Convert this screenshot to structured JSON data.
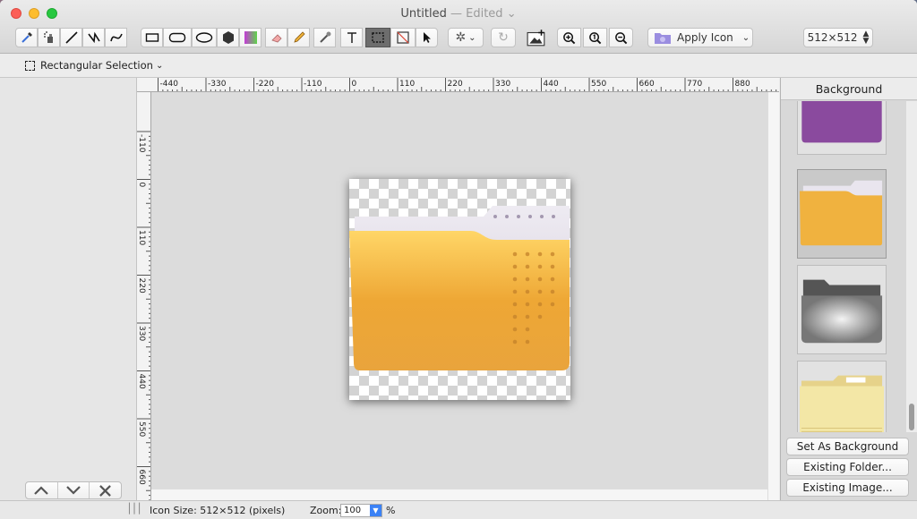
{
  "window": {
    "title": "Untitled",
    "edited": "— Edited"
  },
  "toolbar": {
    "apply_icon_label": "Apply Icon",
    "size_value": "512×512"
  },
  "optionsbar": {
    "tool_name": "Rectangular Selection"
  },
  "ruler": {
    "h": [
      "-440",
      "-330",
      "-220",
      "-110",
      "0",
      "110",
      "220",
      "330",
      "440",
      "550",
      "660",
      "770",
      "880"
    ],
    "v": [
      "-110",
      "0",
      "110",
      "220",
      "330",
      "440",
      "550",
      "660"
    ]
  },
  "panel": {
    "title": "Background",
    "buttons": [
      "Set As Background",
      "Existing Folder...",
      "Existing Image..."
    ]
  },
  "status": {
    "icon_size": "Icon Size: 512×512 (pixels)",
    "zoom_label": "Zoom:",
    "zoom_value": "100",
    "zoom_unit": "%"
  },
  "colors": {
    "accent": "#3b82f6",
    "folder_yellow": "#f2b43d",
    "selected_tool": "#6d6d6d"
  },
  "icons": [
    "eyedropper",
    "spray",
    "line",
    "zigzag",
    "curve",
    "rectangle",
    "rounded-rect",
    "ellipse",
    "hexagon",
    "gradient",
    "eraser",
    "pencil",
    "stamp",
    "text",
    "marquee",
    "crop",
    "arrow",
    "gear",
    "rotate",
    "image-add",
    "zoom-in",
    "zoom-actual",
    "zoom-out",
    "folder"
  ]
}
